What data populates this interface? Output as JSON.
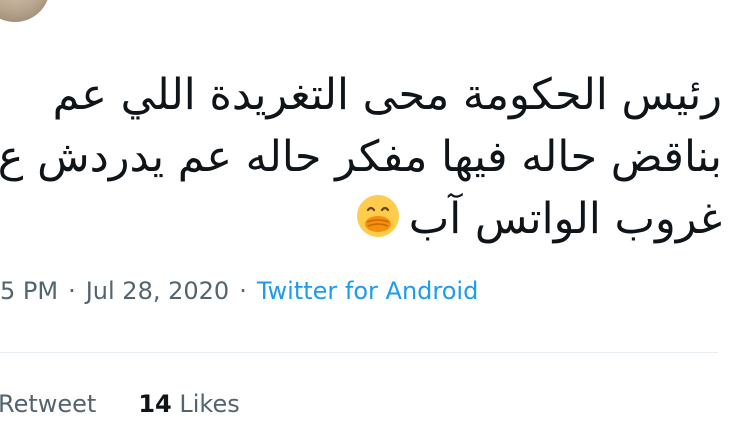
{
  "tweet": {
    "lines": [
      "رئيس الحكومة محى التغريدة اللي عم",
      "بناقض حاله فيها مفكر حاله عم يدردش ع",
      "غروب الواتس آب"
    ],
    "emoji": "face-with-hand-over-mouth-icon"
  },
  "meta": {
    "time": "5 PM",
    "separator": "·",
    "date": "Jul 28, 2020",
    "source": "Twitter for Android"
  },
  "stats": {
    "retweets_label": "Retweet",
    "likes_count": "14",
    "likes_label": "Likes"
  },
  "colors": {
    "text": "#0f1419",
    "secondary": "#536471",
    "link": "#1d9bf0",
    "divider": "#e6ecf0"
  }
}
